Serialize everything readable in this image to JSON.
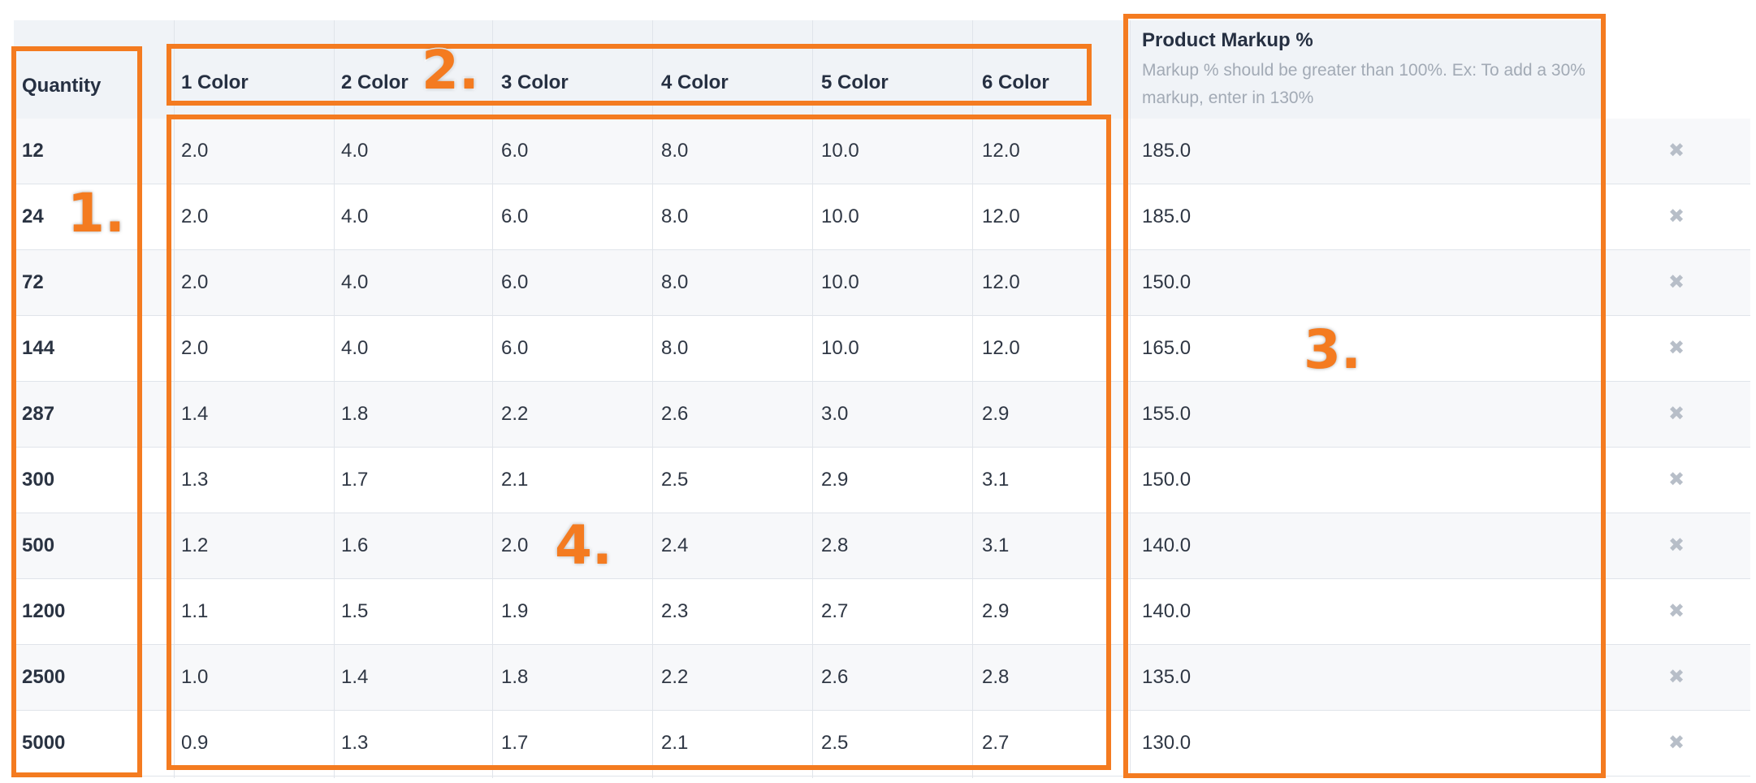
{
  "headers": {
    "quantity": "Quantity",
    "colors": [
      "1 Color",
      "2 Color",
      "3 Color",
      "4 Color",
      "5 Color",
      "6 Color"
    ],
    "markup_title": "Product Markup %",
    "markup_help": "Markup % should be greater than 100%. Ex: To add a 30% markup, enter in 130%"
  },
  "rows": [
    {
      "quantity": "12",
      "colors": [
        "2.0",
        "4.0",
        "6.0",
        "8.0",
        "10.0",
        "12.0"
      ],
      "markup": "185.0"
    },
    {
      "quantity": "24",
      "colors": [
        "2.0",
        "4.0",
        "6.0",
        "8.0",
        "10.0",
        "12.0"
      ],
      "markup": "185.0"
    },
    {
      "quantity": "72",
      "colors": [
        "2.0",
        "4.0",
        "6.0",
        "8.0",
        "10.0",
        "12.0"
      ],
      "markup": "150.0"
    },
    {
      "quantity": "144",
      "colors": [
        "2.0",
        "4.0",
        "6.0",
        "8.0",
        "10.0",
        "12.0"
      ],
      "markup": "165.0"
    },
    {
      "quantity": "287",
      "colors": [
        "1.4",
        "1.8",
        "2.2",
        "2.6",
        "3.0",
        "2.9"
      ],
      "markup": "155.0"
    },
    {
      "quantity": "300",
      "colors": [
        "1.3",
        "1.7",
        "2.1",
        "2.5",
        "2.9",
        "3.1"
      ],
      "markup": "150.0"
    },
    {
      "quantity": "500",
      "colors": [
        "1.2",
        "1.6",
        "2.0",
        "2.4",
        "2.8",
        "3.1"
      ],
      "markup": "140.0"
    },
    {
      "quantity": "1200",
      "colors": [
        "1.1",
        "1.5",
        "1.9",
        "2.3",
        "2.7",
        "2.9"
      ],
      "markup": "140.0"
    },
    {
      "quantity": "2500",
      "colors": [
        "1.0",
        "1.4",
        "1.8",
        "2.2",
        "2.6",
        "2.8"
      ],
      "markup": "135.0"
    },
    {
      "quantity": "5000",
      "colors": [
        "0.9",
        "1.3",
        "1.7",
        "2.1",
        "2.5",
        "2.7"
      ],
      "markup": "130.0"
    }
  ],
  "delete_icon": "close-icon",
  "annotations": [
    "1.",
    "2.",
    "3.",
    "4."
  ],
  "colors": {
    "annotation": "#f47b20",
    "header_bg": "#f0f3f7",
    "row_alt_bg": "#f7f8fa",
    "grid_line": "#e0e4ea",
    "help_text": "#a2aab5",
    "delete_icon": "#b7bec8"
  }
}
